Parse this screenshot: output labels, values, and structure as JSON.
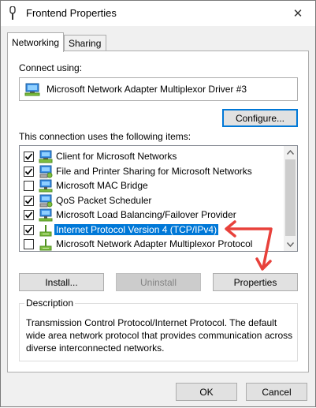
{
  "window": {
    "title": "Frontend Properties",
    "close_glyph": "✕"
  },
  "tabs": [
    {
      "label": "Networking",
      "active": true
    },
    {
      "label": "Sharing",
      "active": false
    }
  ],
  "connect": {
    "label": "Connect using:",
    "adapter_name": "Microsoft Network Adapter Multiplexor Driver #3",
    "adapter_icon": "network-adapter-icon",
    "configure_label": "Configure..."
  },
  "items": {
    "label": "This connection uses the following items:",
    "list": [
      {
        "label": "Client for Microsoft Networks",
        "checked": true,
        "icon": "network-client-icon",
        "selected": false
      },
      {
        "label": "File and Printer Sharing for Microsoft Networks",
        "checked": true,
        "icon": "network-service-icon",
        "selected": false
      },
      {
        "label": "Microsoft MAC Bridge",
        "checked": false,
        "icon": "network-protocol-icon",
        "selected": false
      },
      {
        "label": "QoS Packet Scheduler",
        "checked": true,
        "icon": "network-service-icon",
        "selected": false
      },
      {
        "label": "Microsoft Load Balancing/Failover Provider",
        "checked": true,
        "icon": "network-protocol-icon",
        "selected": false
      },
      {
        "label": "Internet Protocol Version 4 (TCP/IPv4)",
        "checked": true,
        "icon": "protocol-icon",
        "selected": true
      },
      {
        "label": "Microsoft Network Adapter Multiplexor Protocol",
        "checked": false,
        "icon": "protocol-icon",
        "selected": false
      }
    ]
  },
  "buttons": {
    "install": "Install...",
    "uninstall": "Uninstall",
    "properties": "Properties"
  },
  "description": {
    "legend": "Description",
    "text": "Transmission Control Protocol/Internet Protocol. The default wide area network protocol that provides communication across diverse interconnected networks."
  },
  "footer": {
    "ok": "OK",
    "cancel": "Cancel"
  },
  "colors": {
    "selection": "#0078d7",
    "annotation_arrow": "#e8413b"
  }
}
